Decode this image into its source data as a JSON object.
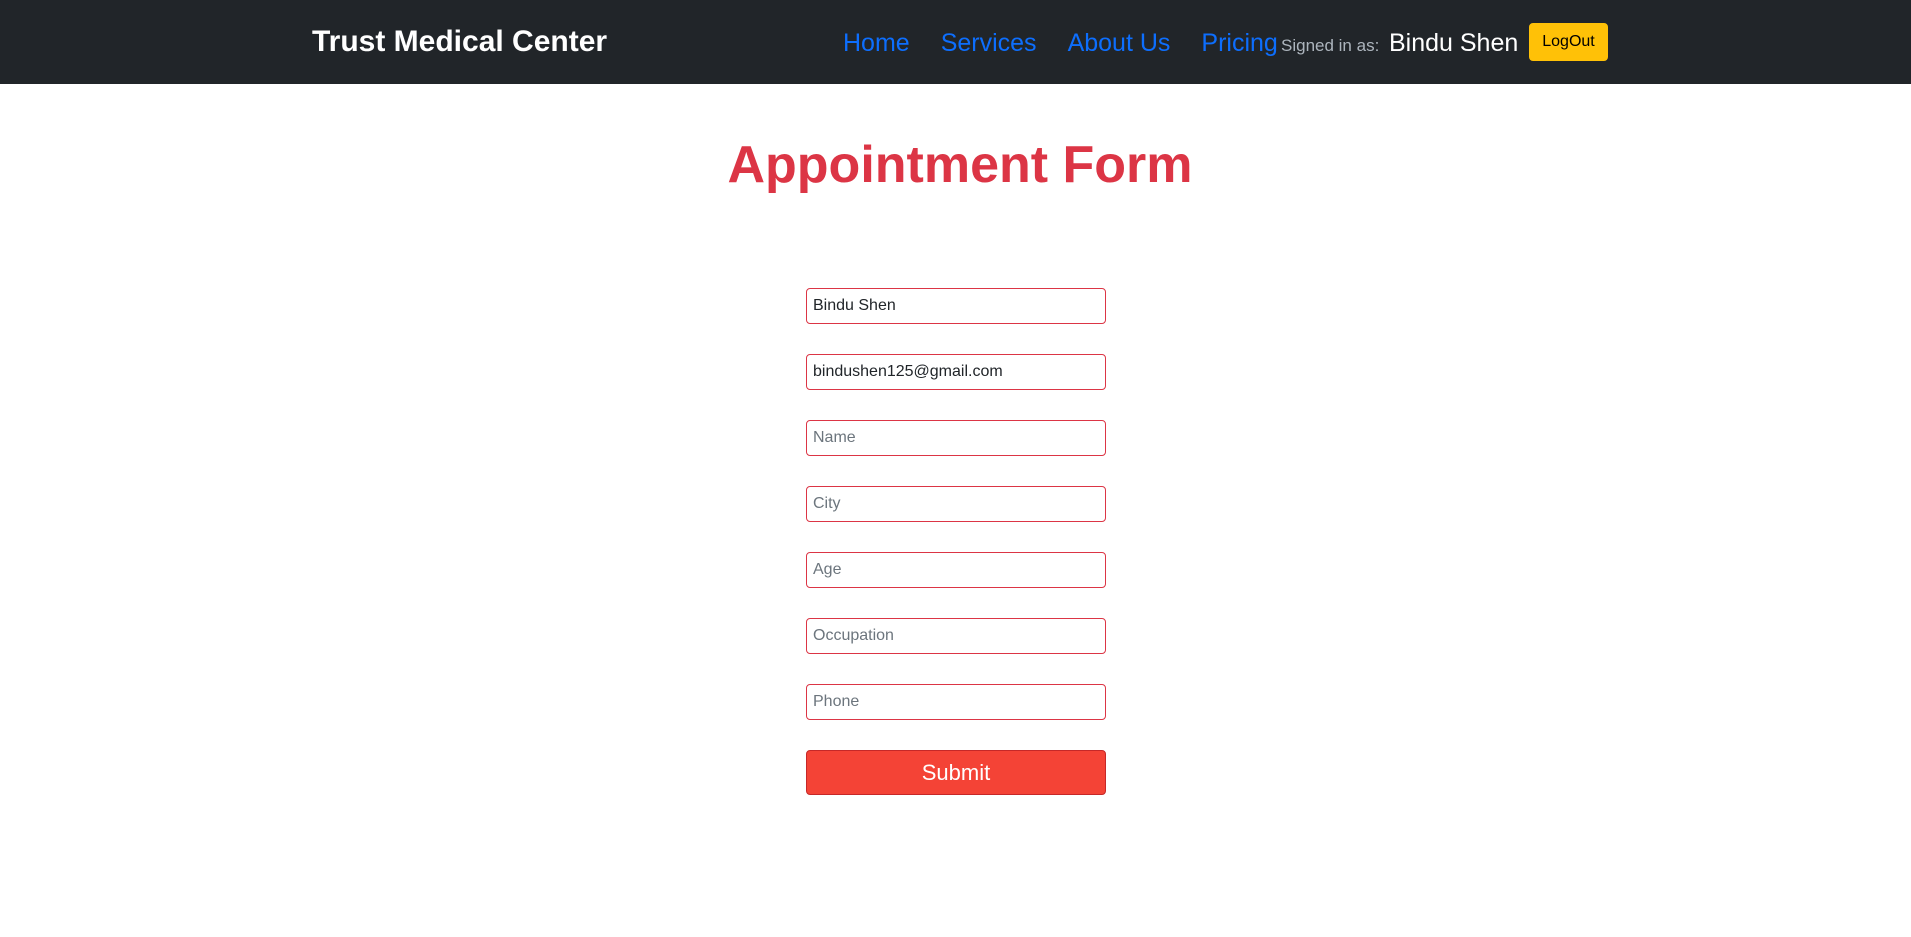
{
  "navbar": {
    "brand": "Trust Medical Center",
    "links": [
      "Home",
      "Services",
      "About Us",
      "Pricing"
    ],
    "signed_in_label": "Signed in as:",
    "user_name": "Bindu Shen",
    "logout_label": "LogOut"
  },
  "form": {
    "title": "Appointment Form",
    "fields": [
      {
        "value": "Bindu Shen",
        "placeholder": ""
      },
      {
        "value": "bindushen125@gmail.com",
        "placeholder": ""
      },
      {
        "value": "",
        "placeholder": "Name"
      },
      {
        "value": "",
        "placeholder": "City"
      },
      {
        "value": "",
        "placeholder": "Age"
      },
      {
        "value": "",
        "placeholder": "Occupation"
      },
      {
        "value": "",
        "placeholder": "Phone"
      }
    ],
    "submit_label": "Submit"
  },
  "colors": {
    "navbar_bg": "#212529",
    "link": "#0d6efd",
    "title": "#dc3545",
    "field_border": "#dc3545",
    "logout_bg": "#ffc107",
    "submit_bg": "#f44336"
  }
}
